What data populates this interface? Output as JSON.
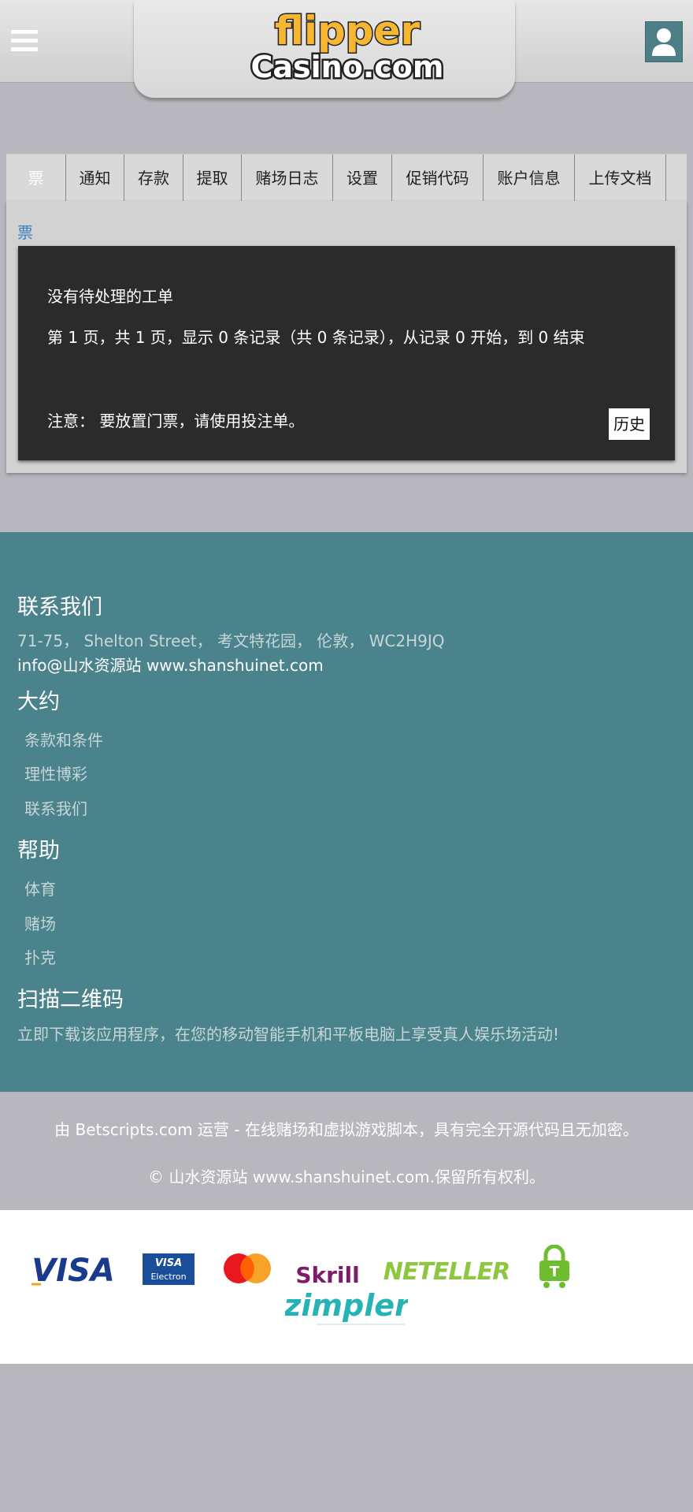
{
  "header": {
    "logo_line1": "flipper",
    "logo_line2": "Casino.com"
  },
  "tabs": [
    {
      "label": "票"
    },
    {
      "label": "通知"
    },
    {
      "label": "存款"
    },
    {
      "label": "提取"
    },
    {
      "label": "赌场日志"
    },
    {
      "label": "设置"
    },
    {
      "label": "促销代码"
    },
    {
      "label": "账户信息"
    },
    {
      "label": "上传文档"
    }
  ],
  "panel": {
    "breadcrumb": "票",
    "no_tickets": "没有待处理的工单",
    "paging": "第 1 页，共 1 页，显示 0 条记录（共 0 条记录），从记录 0 开始，到 0 结束",
    "note": "注意： 要放置门票，请使用投注单。",
    "history_button": "历史"
  },
  "footer": {
    "contact_heading": "联系我们",
    "address": "71-75， Shelton Street， 考文特花园， 伦敦， WC2H9JQ",
    "email": "info@山水资源站 www.shanshuinet.com",
    "about_heading": "大约",
    "about_links": [
      "条款和条件",
      "理性博彩",
      "联系我们"
    ],
    "help_heading": "帮助",
    "help_links": [
      "体育",
      "赌场",
      "扑克"
    ],
    "qr_heading": "扫描二维码",
    "qr_text": "立即下载该应用程序，在您的移动智能手机和平板电脑上享受真人娱乐场活动!",
    "powered_by": "由 Betscripts.com 运营 - 在线赌场和虚拟游戏脚本，具有完全开源代码且无加密。",
    "copyright": "© 山水资源站 www.shanshuinet.com.保留所有权利。"
  },
  "payments": {
    "visa": "VISA",
    "visa_electron_top": "VISA",
    "visa_electron_bottom": "Electron",
    "skrill": "Skrill",
    "neteller": "NETELLER",
    "zimpler": "zimpler",
    "lock_letter": "T"
  },
  "colors": {
    "teal": "#4b838c",
    "logo_yellow": "#f5b731",
    "link_blue": "#3a7fc4"
  }
}
